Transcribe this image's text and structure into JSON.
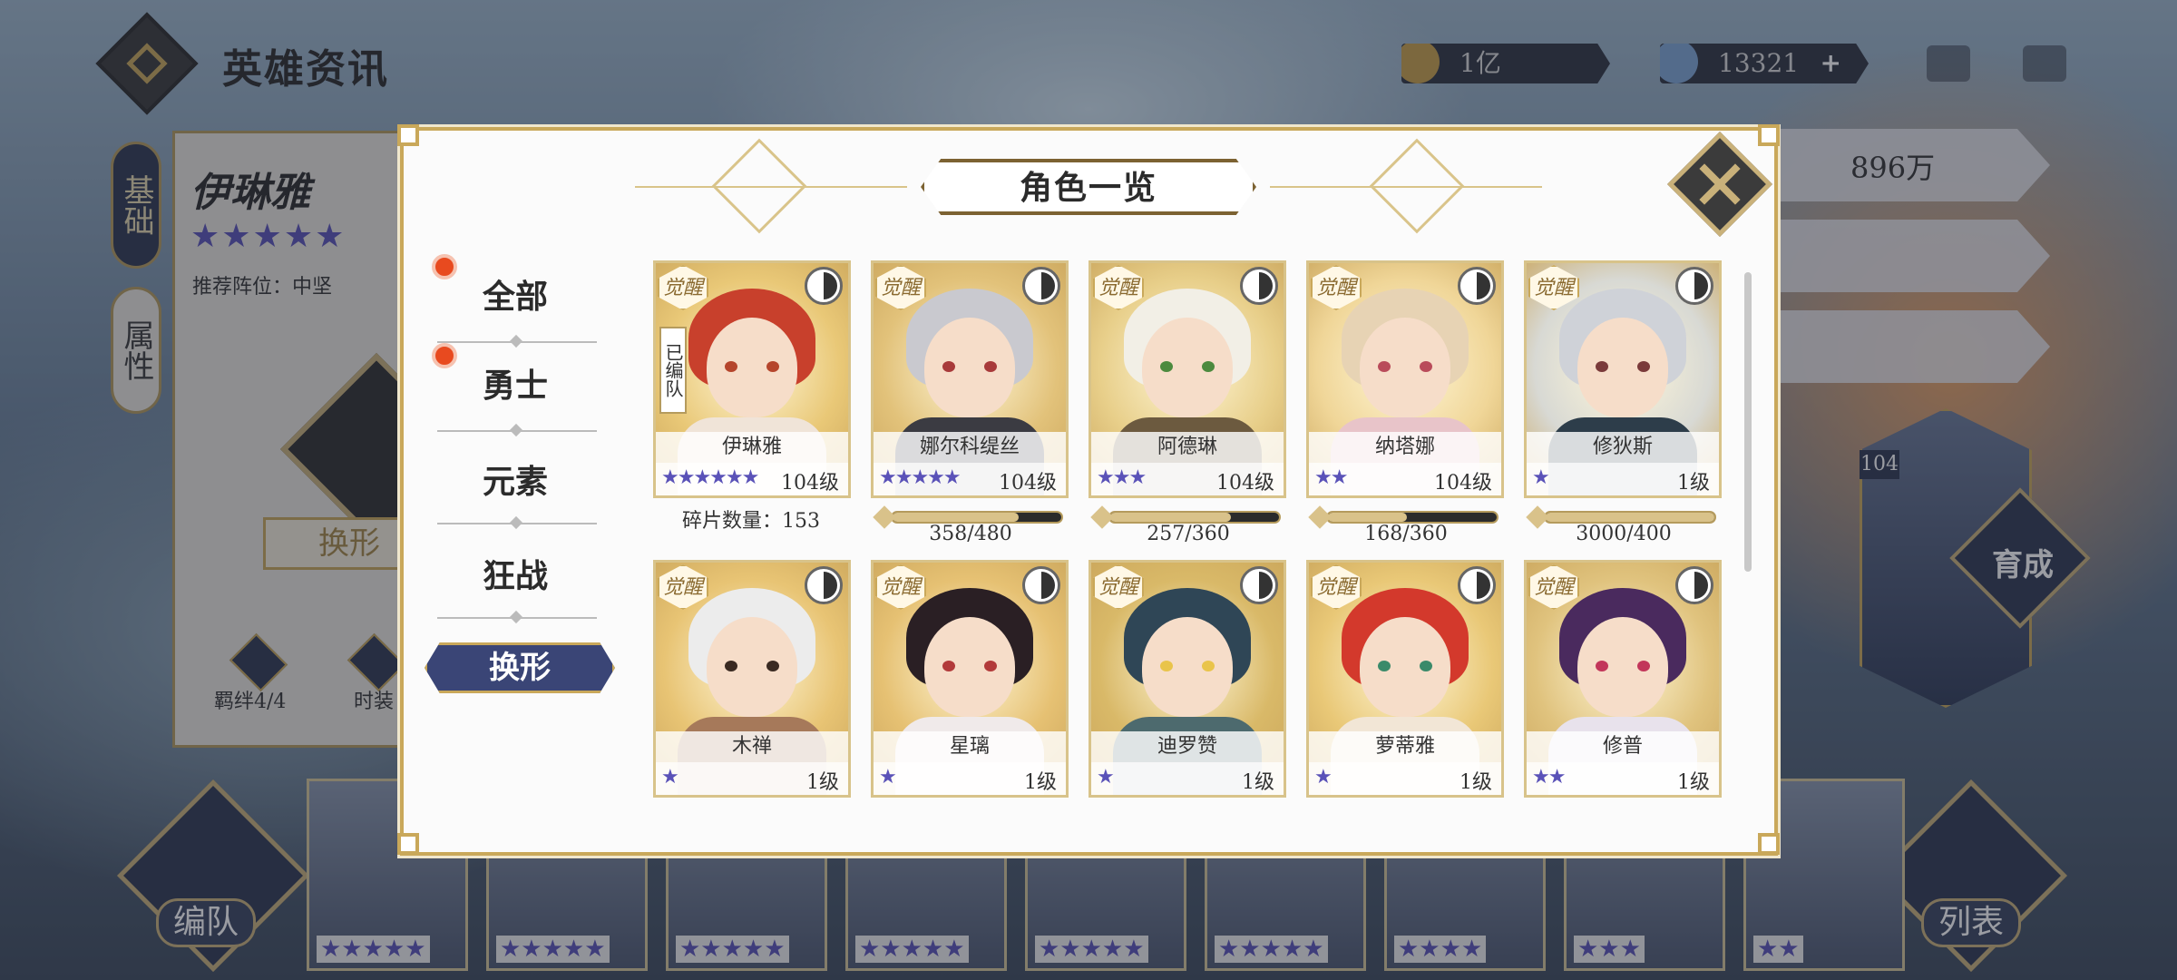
{
  "header": {
    "title": "英雄资讯",
    "gold": "1亿",
    "gem": "13321",
    "plus": "+"
  },
  "left_panel": {
    "tab_basic": "基础",
    "tab_attr": "属性",
    "hero_name": "伊琳雅",
    "stars": "★★★★★",
    "position": "推荐阵位：中坚",
    "transform_btn": "换形",
    "bond": "羁绊4/4",
    "time": "时装"
  },
  "right_panel": {
    "currency": "896万",
    "grow": "育成",
    "level": "104"
  },
  "bottom": {
    "team": "编队",
    "list": "列表",
    "card_stars": [
      "★★★★★",
      "★★★★★",
      "★★★★★",
      "★★★★★",
      "★★★★★",
      "★★★★★",
      "★★★★",
      "★★★",
      "★★"
    ]
  },
  "modal": {
    "title": "角色一览",
    "filters": [
      "全部",
      "勇士",
      "元素",
      "狂战"
    ],
    "transform_tab": "换形",
    "awaken": "觉醒",
    "edited": "已编队",
    "shard_label": "碎片数量：153",
    "cards": [
      {
        "name": "伊琳雅",
        "stars": "★★★★★★",
        "level": "104级",
        "hair": "#c8402c",
        "eye": "#b5452c",
        "body": "#f0e4d8",
        "bg": "#e9c877"
      },
      {
        "name": "娜尔科缇丝",
        "stars": "★★★★★",
        "level": "104级",
        "hair": "#c9c9cf",
        "eye": "#a83a3a",
        "body": "#3b3b42",
        "bg": "#e2c27a"
      },
      {
        "name": "阿德琳",
        "stars": "★★★",
        "level": "104级",
        "hair": "#f2efe6",
        "eye": "#4c8a3e",
        "body": "#6c5a3f",
        "bg": "#e8cf8a"
      },
      {
        "name": "纳塔娜",
        "stars": "★★",
        "level": "104级",
        "hair": "#e7d3b4",
        "eye": "#b94b5a",
        "body": "#e8c4c9",
        "bg": "#f0d698"
      },
      {
        "name": "修狄斯",
        "stars": "★",
        "level": "1级",
        "hair": "#cfd2d8",
        "eye": "#7a3a3a",
        "body": "#2d3d4a",
        "bg": "#d8d9d4"
      },
      {
        "name": "木禅",
        "stars": "★",
        "level": "1级",
        "hair": "#ececec",
        "eye": "#3a2a22",
        "body": "#a6795a",
        "bg": "#e8c474"
      },
      {
        "name": "星璃",
        "stars": "★",
        "level": "1级",
        "hair": "#2a1f24",
        "eye": "#b23a3a",
        "body": "#f0eaea",
        "bg": "#e6c173"
      },
      {
        "name": "迪罗赞",
        "stars": "★",
        "level": "1级",
        "hair": "#2f4656",
        "eye": "#e9c44a",
        "body": "#4d6a6e",
        "bg": "#d9b968"
      },
      {
        "name": "萝蒂雅",
        "stars": "★",
        "level": "1级",
        "hair": "#d3392c",
        "eye": "#3a8a6a",
        "body": "#f2e6d6",
        "bg": "#e9c877"
      },
      {
        "name": "修普",
        "stars": "★★",
        "level": "1级",
        "hair": "#4a2a5e",
        "eye": "#c2365a",
        "body": "#e8e2ec",
        "bg": "#e0c37e"
      }
    ],
    "progress": [
      {
        "text": "358/480",
        "fraction": 0.746
      },
      {
        "text": "257/360",
        "fraction": 0.714
      },
      {
        "text": "168/360",
        "fraction": 0.467
      },
      {
        "text": "3000/400",
        "fraction": 1.0
      }
    ]
  }
}
